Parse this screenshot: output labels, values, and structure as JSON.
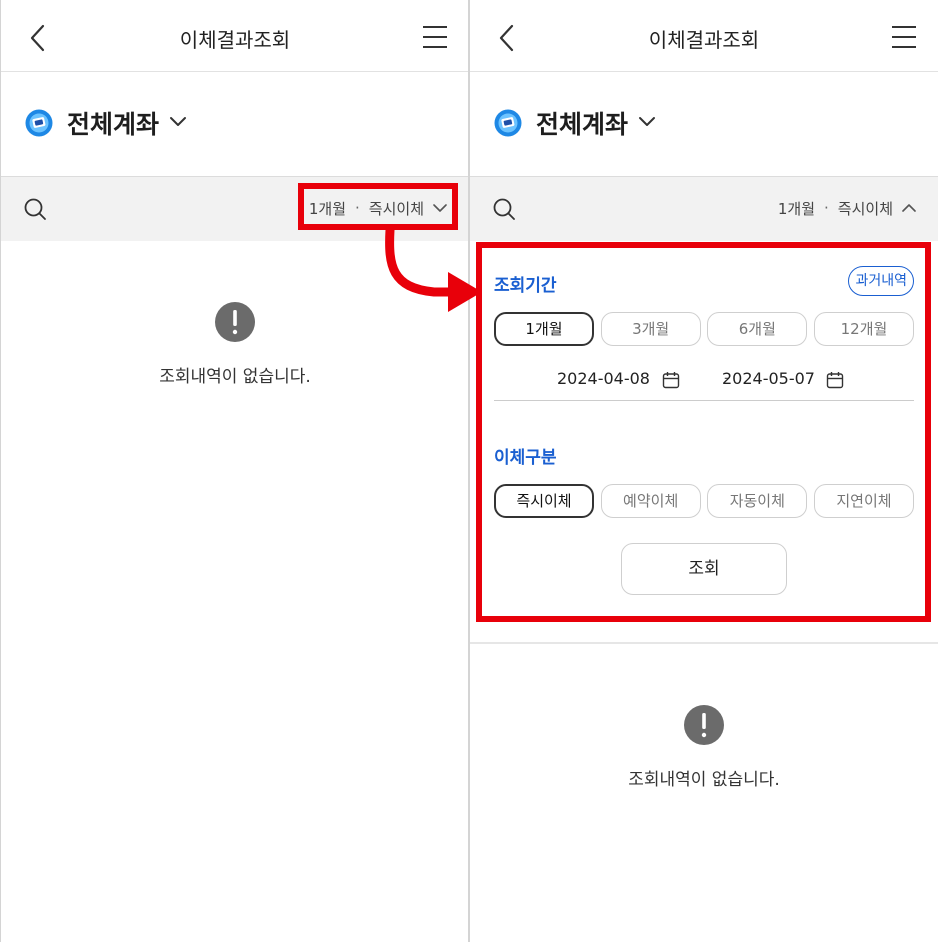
{
  "left": {
    "title": "이체결과조회",
    "account_name": "전체계좌",
    "filter": {
      "period": "1개월",
      "separator": "·",
      "type": "즉시이체"
    },
    "empty_message": "조회내역이 없습니다."
  },
  "right": {
    "title": "이체결과조회",
    "account_name": "전체계좌",
    "filter": {
      "period": "1개월",
      "separator": "·",
      "type": "즉시이체"
    },
    "period_section": {
      "label": "조회기간",
      "history_button": "과거내역",
      "options": [
        "1개월",
        "3개월",
        "6개월",
        "12개월"
      ],
      "selected": "1개월",
      "start_date": "2024-04-08",
      "date_separator": "-",
      "end_date": "2024-05-07"
    },
    "type_section": {
      "label": "이체구분",
      "options": [
        "즉시이체",
        "예약이체",
        "자동이체",
        "지연이체"
      ],
      "selected": "즉시이체"
    },
    "query_button": "조회",
    "empty_message": "조회내역이 없습니다."
  },
  "colors": {
    "accent_blue": "#1a5fd1",
    "highlight_red": "#e8000a",
    "filter_bar_bg": "#f2f2f2",
    "empty_icon_gray": "#6b6b6b"
  }
}
